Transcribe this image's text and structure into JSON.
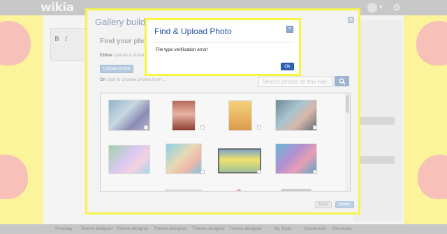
{
  "app": {
    "wordmark": "wikia"
  },
  "gallery_modal": {
    "title": "Gallery builder",
    "close_glyph": "×",
    "heading": "Find your photo",
    "either_strong": "Either",
    "either_text": " upload a photo",
    "upload_button": "Upload photo",
    "or_strong": "Or",
    "or_text": " click to choose photos from ...",
    "search_placeholder": "Search photos on this wiki",
    "back_button": "Back",
    "select_button": "Select"
  },
  "error_dialog": {
    "title": "Find & Upload Photo",
    "close_glyph": "×",
    "message": "File type verification error!",
    "ok_button": "Ok"
  },
  "bottom_bar": {
    "items": [
      "Timeway",
      "Theme designer",
      "Theme designer",
      "Theme designer",
      "Theme designer",
      "Theme designer",
      "My Tools",
      "Customize",
      "Shortcuts"
    ]
  },
  "colors": {
    "error_title": "#2550a6",
    "ok_button": "#2e63b8",
    "modal_border": "#f7f53f",
    "select_button": "#bcd0e6"
  },
  "icons": [
    "search-icon",
    "close-icon",
    "gear-icon",
    "chevron-down-icon",
    "bold-icon",
    "italic-icon"
  ]
}
